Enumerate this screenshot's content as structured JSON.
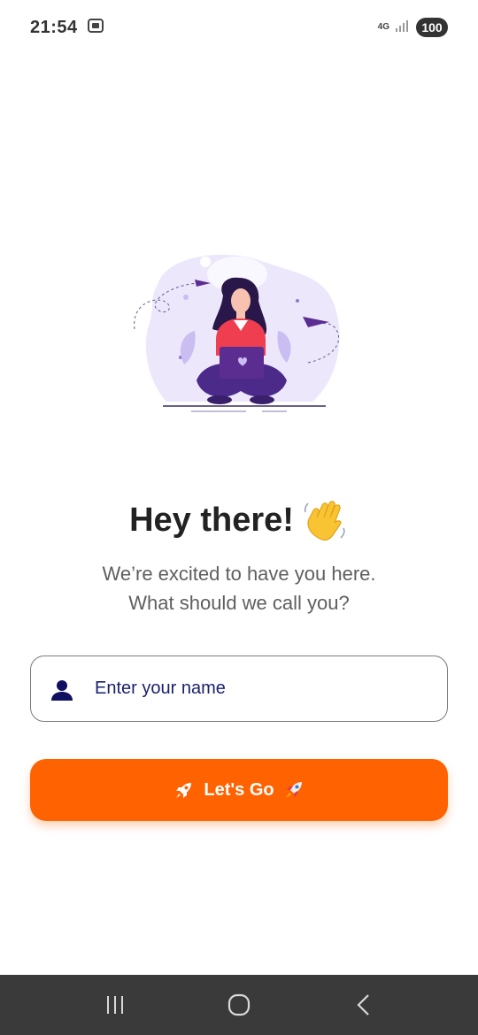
{
  "status_bar": {
    "time": "21:54",
    "network": "4G",
    "battery": "100"
  },
  "welcome": {
    "title": "Hey there!",
    "subtitle_line1": "We’re excited to have you here.",
    "subtitle_line2": "What should we call you?"
  },
  "name_field": {
    "placeholder": "Enter your name",
    "value": ""
  },
  "go_button": {
    "label": "Let's Go"
  },
  "icons": {
    "screenshot": "screenshot-icon",
    "signal": "signal-icon",
    "person": "person-icon",
    "rocket": "rocket-icon",
    "wave": "waving-hand-icon"
  },
  "colors": {
    "accent": "#ff6200",
    "placeholder": "#1b1f6e",
    "illustration_purple": "#5b2d91",
    "illustration_red": "#ee3e4f"
  }
}
